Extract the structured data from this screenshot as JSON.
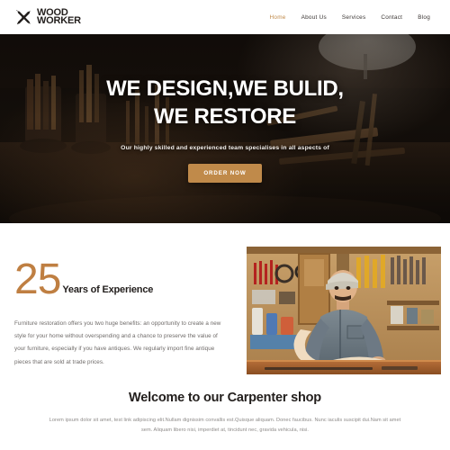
{
  "header": {
    "brand": {
      "line1": "WOOD",
      "line2": "WORKER",
      "icon": "crossed-tools-icon"
    },
    "nav": [
      {
        "label": "Home",
        "active": true
      },
      {
        "label": "About Us",
        "active": false
      },
      {
        "label": "Services",
        "active": false
      },
      {
        "label": "Contact",
        "active": false
      },
      {
        "label": "Blog",
        "active": false
      }
    ]
  },
  "hero": {
    "headline_line1": "WE DESIGN,WE BULID,",
    "headline_line2": "WE RESTORE",
    "subtitle": "Our highly skilled and experienced team specialises in all aspects of",
    "cta_label": "ORDER NOW",
    "background": "dark-workshop-tools-photo"
  },
  "about": {
    "years_number": "25",
    "years_label": "Years of Experience",
    "paragraph": "Furniture restoration offers you two huge benefits: an opportunity to create a new style for your home without overspending and a chance to preserve the value of your furniture, especially if you have antiques. We regularly import fine antique pieces that are sold at trade prices.",
    "photo_alt": "carpenter-shaping-wood-photo"
  },
  "welcome": {
    "heading": "Welcome to our Carpenter shop",
    "paragraph": "Lorem ipsum dolor sit amet, test link adipiscing elit.Nullam dignissim convallis est.Quisque aliquam. Donec faucibus. Nunc iaculis suscipit dui.Nam sit amet sem. Aliquam libero nisi, imperdiet at, tincidunt nec, gravida vehicula, nisi."
  },
  "colors": {
    "accent": "#c08a4a",
    "accent_number": "#bf7f42",
    "ink": "#221e1c",
    "body_text": "#6e6a68",
    "muted_text": "#8d8a88",
    "hero_bg": "#130f0d"
  }
}
